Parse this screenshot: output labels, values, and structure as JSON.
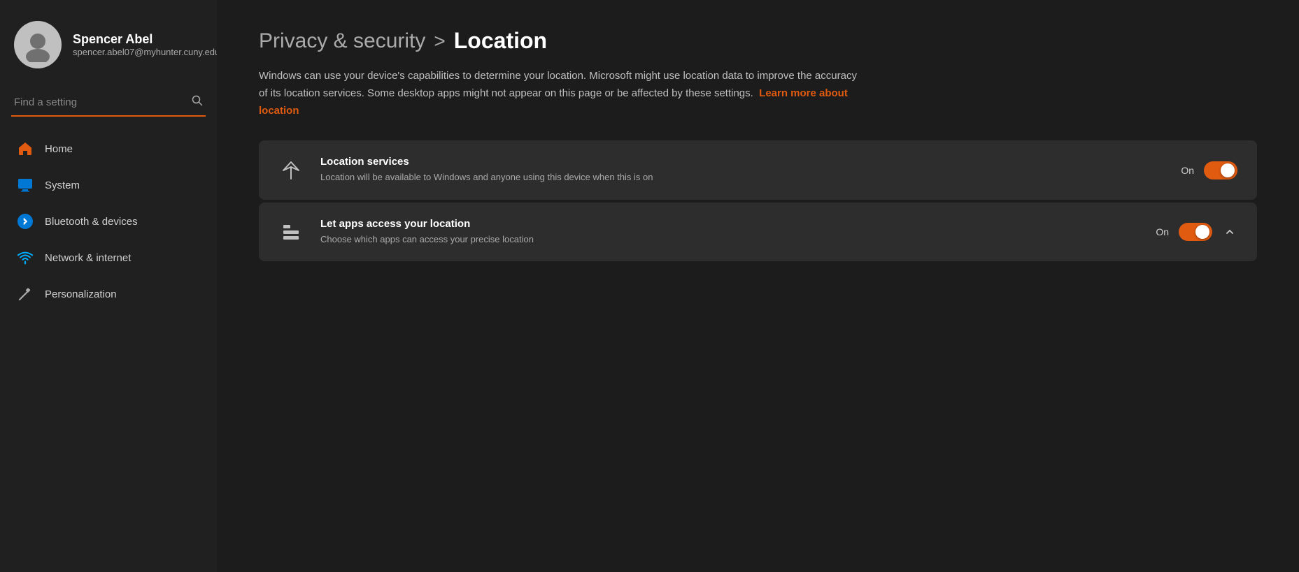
{
  "sidebar": {
    "user": {
      "name": "Spencer Abel",
      "email": "spencer.abel07@myhunter.cuny.edu"
    },
    "search": {
      "placeholder": "Find a setting"
    },
    "nav_items": [
      {
        "id": "home",
        "label": "Home",
        "icon": "home"
      },
      {
        "id": "system",
        "label": "System",
        "icon": "system"
      },
      {
        "id": "bluetooth",
        "label": "Bluetooth & devices",
        "icon": "bluetooth"
      },
      {
        "id": "network",
        "label": "Network & internet",
        "icon": "network"
      },
      {
        "id": "personalization",
        "label": "Personalization",
        "icon": "personalization"
      }
    ]
  },
  "main": {
    "breadcrumb": {
      "parent": "Privacy & security",
      "separator": ">",
      "current": "Location"
    },
    "description": "Windows can use your device's capabilities to determine your location. Microsoft might use location data to improve the accuracy of its location services. Some desktop apps might not appear on this page or be affected by these settings.",
    "learn_more_text": "Learn more about location",
    "settings": [
      {
        "id": "location-services",
        "title": "Location services",
        "subtitle": "Location will be available to Windows and anyone using this device when this is on",
        "toggle_label": "On",
        "toggle_state": true,
        "has_chevron": false,
        "icon": "location"
      },
      {
        "id": "apps-location",
        "title": "Let apps access your location",
        "subtitle": "Choose which apps can access your precise location",
        "toggle_label": "On",
        "toggle_state": true,
        "has_chevron": true,
        "icon": "apps"
      }
    ]
  },
  "icons": {
    "search": "🔍",
    "home": "⌂",
    "system": "🖥",
    "bluetooth": "⬡",
    "network": "📶",
    "personalization": "✏"
  }
}
